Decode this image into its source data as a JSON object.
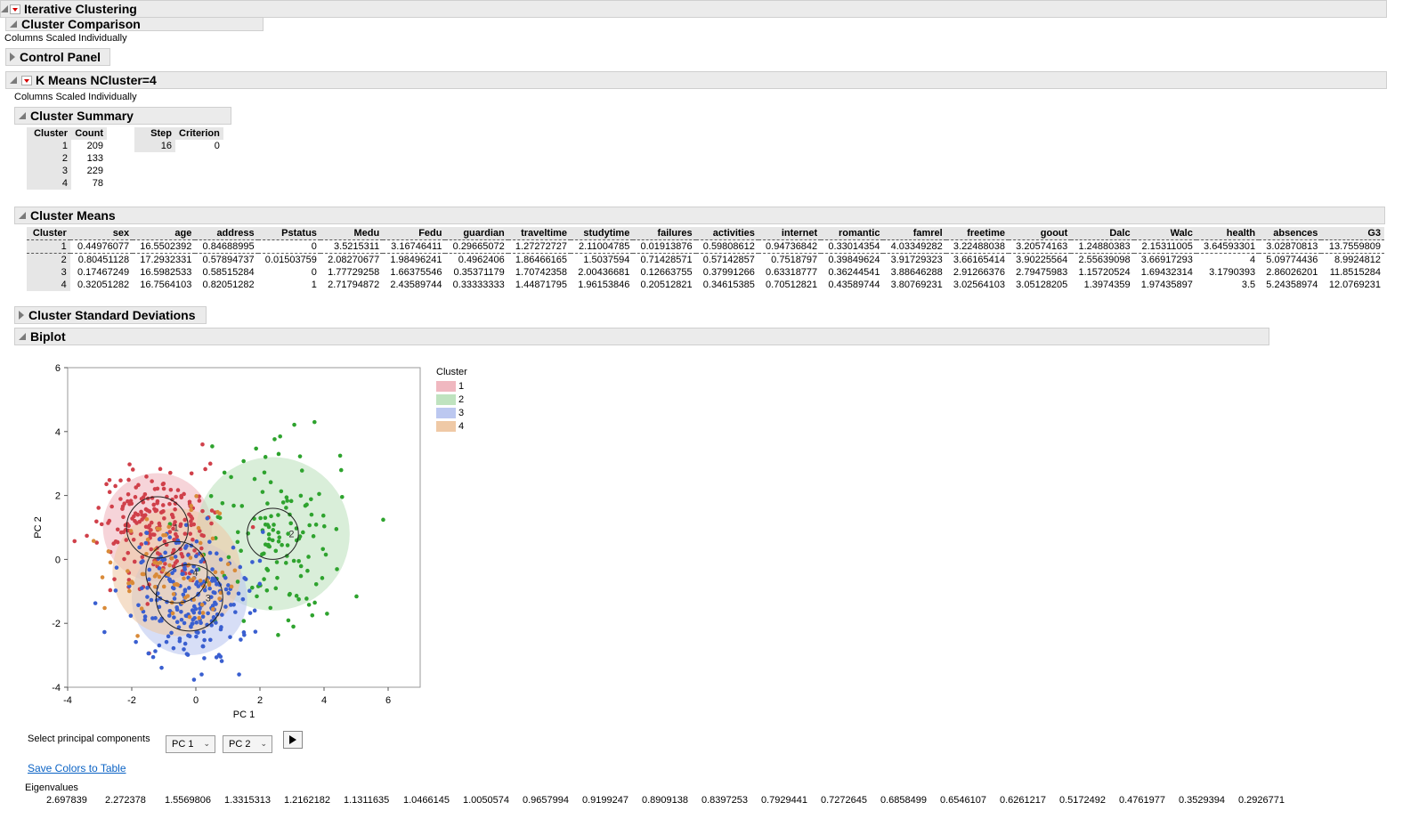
{
  "platform": {
    "title": "Iterative Clustering"
  },
  "cluster_comparison": {
    "title": "Cluster Comparison"
  },
  "scaling_note": "Columns Scaled Individually",
  "control_panel": {
    "title": "Control Panel"
  },
  "kmeans": {
    "title": "K Means NCluster=4",
    "scaling_note": "Columns Scaled Individually"
  },
  "cluster_summary": {
    "title": "Cluster Summary",
    "headers": [
      "Cluster",
      "Count"
    ],
    "rows": [
      [
        "1",
        "209"
      ],
      [
        "2",
        "133"
      ],
      [
        "3",
        "229"
      ],
      [
        "4",
        "78"
      ]
    ],
    "step_headers": [
      "Step",
      "Criterion"
    ],
    "step_row": [
      "16",
      "0"
    ]
  },
  "cluster_means": {
    "title": "Cluster Means",
    "headers": [
      "Cluster",
      "sex",
      "age",
      "address",
      "Pstatus",
      "Medu",
      "Fedu",
      "guardian",
      "traveltime",
      "studytime",
      "failures",
      "activities",
      "internet",
      "romantic",
      "famrel",
      "freetime",
      "goout",
      "Dalc",
      "Walc",
      "health",
      "absences",
      "G3"
    ],
    "rows": [
      [
        "1",
        "0.44976077",
        "16.5502392",
        "0.84688995",
        "0",
        "3.5215311",
        "3.16746411",
        "0.29665072",
        "1.27272727",
        "2.11004785",
        "0.01913876",
        "0.59808612",
        "0.94736842",
        "0.33014354",
        "4.03349282",
        "3.22488038",
        "3.20574163",
        "1.24880383",
        "2.15311005",
        "3.64593301",
        "3.02870813",
        "13.7559809"
      ],
      [
        "2",
        "0.80451128",
        "17.2932331",
        "0.57894737",
        "0.01503759",
        "2.08270677",
        "1.98496241",
        "0.4962406",
        "1.86466165",
        "1.5037594",
        "0.71428571",
        "0.57142857",
        "0.7518797",
        "0.39849624",
        "3.91729323",
        "3.66165414",
        "3.90225564",
        "2.55639098",
        "3.66917293",
        "4",
        "5.09774436",
        "8.9924812"
      ],
      [
        "3",
        "0.17467249",
        "16.5982533",
        "0.58515284",
        "0",
        "1.77729258",
        "1.66375546",
        "0.35371179",
        "1.70742358",
        "2.00436681",
        "0.12663755",
        "0.37991266",
        "0.63318777",
        "0.36244541",
        "3.88646288",
        "2.91266376",
        "2.79475983",
        "1.15720524",
        "1.69432314",
        "3.1790393",
        "2.86026201",
        "11.8515284"
      ],
      [
        "4",
        "0.32051282",
        "16.7564103",
        "0.82051282",
        "1",
        "2.71794872",
        "2.43589744",
        "0.33333333",
        "1.44871795",
        "1.96153846",
        "0.20512821",
        "0.34615385",
        "0.70512821",
        "0.43589744",
        "3.80769231",
        "3.02564103",
        "3.05128205",
        "1.3974359",
        "1.97435897",
        "3.5",
        "5.24358974",
        "12.0769231"
      ]
    ]
  },
  "cluster_sd": {
    "title": "Cluster Standard Deviations"
  },
  "biplot": {
    "title": "Biplot",
    "legend_title": "Cluster",
    "select_label": "Select principal components",
    "pc_x": "PC 1",
    "pc_y": "PC 2",
    "save_link": "Save Colors to Table",
    "eigen_title": "Eigenvalues",
    "eigenvalues": [
      "2.697839",
      "2.272378",
      "1.5569806",
      "1.3315313",
      "1.2162182",
      "1.1311635",
      "1.0466145",
      "1.0050574",
      "0.9657994",
      "0.9199247",
      "0.8909138",
      "0.8397253",
      "0.7929441",
      "0.7272645",
      "0.6858499",
      "0.6546107",
      "0.6261217",
      "0.5172492",
      "0.4761977",
      "0.3529394",
      "0.2926771"
    ]
  },
  "chart_data": {
    "type": "scatter",
    "xlabel": "PC 1",
    "ylabel": "PC 2",
    "xlim": [
      -4,
      7
    ],
    "ylim": [
      -4,
      6
    ],
    "xticks": [
      "-4",
      "-2",
      "0",
      "2",
      "4",
      "6"
    ],
    "yticks": [
      "-4",
      "-2",
      "0",
      "2",
      "4",
      "6"
    ],
    "legend": {
      "title": "Cluster",
      "placement": "right"
    },
    "series": [
      {
        "name": "1",
        "color": "#d0404a",
        "fill": "#f0b8c0",
        "center": [
          -1.2,
          1.0
        ],
        "radius_inner": 1.2,
        "radius_outer": 1.7,
        "count": 209,
        "spread": [
          0.9,
          0.9
        ]
      },
      {
        "name": "2",
        "color": "#2ea32e",
        "fill": "#bfe3bf",
        "center": [
          2.4,
          0.8
        ],
        "radius_inner": 1.0,
        "radius_outer": 2.4,
        "count": 133,
        "spread": [
          1.2,
          1.4
        ]
      },
      {
        "name": "3",
        "color": "#3a5fd0",
        "fill": "#bcc8f0",
        "center": [
          -0.2,
          -1.2
        ],
        "radius_inner": 1.3,
        "radius_outer": 1.8,
        "count": 229,
        "spread": [
          0.9,
          1.0
        ]
      },
      {
        "name": "4",
        "color": "#d98a38",
        "fill": "#efc9a6",
        "center": [
          -0.6,
          -0.4
        ],
        "radius_inner": 1.2,
        "radius_outer": 2.0,
        "count": 78,
        "spread": [
          0.9,
          1.0
        ]
      }
    ]
  }
}
